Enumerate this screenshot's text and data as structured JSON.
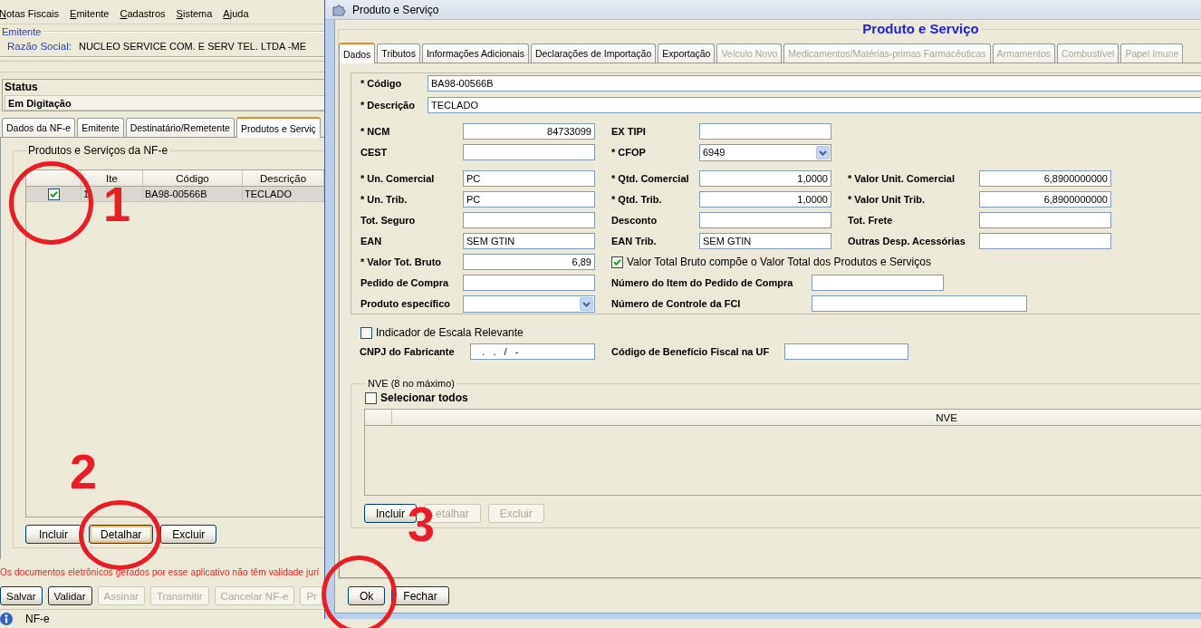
{
  "main_window": {
    "menu": [
      {
        "label": "Notas Fiscais"
      },
      {
        "label": "Emitente"
      },
      {
        "label": "Cadastros"
      },
      {
        "label": "Sistema"
      },
      {
        "label": "Ajuda"
      }
    ],
    "issuer": {
      "legend": "Emitente",
      "label": "Razão Social:",
      "value": "NUCLEO SERVICE COM. E SERV TEL. LTDA -ME"
    },
    "status": {
      "label": "Status",
      "value": "Em Digitação"
    },
    "tabs": [
      {
        "label": "Dados da NF-e",
        "selected": false
      },
      {
        "label": "Emitente",
        "selected": false
      },
      {
        "label": "Destinatário/Remetente",
        "selected": false
      },
      {
        "label": "Produtos e Serviç",
        "selected": true
      }
    ],
    "products": {
      "legend": "Produtos e Serviços da NF-e",
      "columns": [
        "Ite",
        "Código",
        "Descrição"
      ],
      "rows": [
        {
          "selected": true,
          "checked": true,
          "cells": [
            "1",
            "BA98-00566B",
            "TECLADO"
          ]
        }
      ],
      "buttons": [
        {
          "label": "Incluir",
          "focused": false
        },
        {
          "label": "Detalhar",
          "focused": true
        },
        {
          "label": "Excluir",
          "focused": false
        }
      ]
    },
    "notice": "Os documentos eletrônicos gerados por esse aplicativo não têm validade jurí",
    "actions": [
      {
        "label": "Salvar",
        "disabled": false
      },
      {
        "label": "Validar",
        "disabled": false
      },
      {
        "label": "Assinar",
        "disabled": true
      },
      {
        "label": "Transmitir",
        "disabled": true
      },
      {
        "label": "Cancelar NF-e",
        "disabled": true
      },
      {
        "label": "Pr",
        "disabled": true
      }
    ],
    "status_bar": {
      "text": "NF-e"
    }
  },
  "dialog": {
    "title": "Produto e Serviço",
    "heading": "Produto e Serviço",
    "tabs": [
      {
        "label": "Dados",
        "selected": true,
        "disabled": false
      },
      {
        "label": "Tributos",
        "selected": false,
        "disabled": false
      },
      {
        "label": "Informações Adicionais",
        "selected": false,
        "disabled": false
      },
      {
        "label": "Declarações de Importação",
        "selected": false,
        "disabled": false
      },
      {
        "label": "Exportação",
        "selected": false,
        "disabled": false
      },
      {
        "label": "Veículo Novo",
        "selected": false,
        "disabled": true
      },
      {
        "label": "Medicamentos/Matérias-primas Farmacêuticas",
        "selected": false,
        "disabled": true
      },
      {
        "label": "Armamentos",
        "selected": false,
        "disabled": true
      },
      {
        "label": "Combustível",
        "selected": false,
        "disabled": true
      },
      {
        "label": "Papel Imune",
        "selected": false,
        "disabled": true
      }
    ],
    "header_fields": [
      {
        "label": "* Código",
        "value": "BA98-00566B"
      },
      {
        "label": "* Descrição",
        "value": "TECLADO"
      }
    ],
    "field_groups": [
      [
        [
          {
            "kind": "number",
            "label": "* NCM",
            "value": "84733099"
          },
          {
            "kind": "text",
            "label": "EX TIPI"
          }
        ],
        [
          {
            "kind": "text",
            "label": "CEST"
          },
          {
            "kind": "select",
            "label": "* CFOP",
            "value": "6949"
          }
        ]
      ],
      [
        [
          {
            "kind": "text",
            "label": "* Un. Comercial",
            "value": "PC"
          },
          {
            "kind": "number",
            "label": "* Qtd. Comercial",
            "value": "1,0000"
          },
          {
            "kind": "number",
            "label": "* Valor Unit. Comercial",
            "value": "6,8900000000"
          }
        ],
        [
          {
            "kind": "text",
            "label": "* Un. Trib.",
            "value": "PC"
          },
          {
            "kind": "number",
            "label": "* Qtd. Trib.",
            "value": "1,0000"
          },
          {
            "kind": "number",
            "label": "* Valor Unit Trib.",
            "value": "6,8900000000"
          }
        ],
        [
          {
            "kind": "text",
            "label": "Tot. Seguro"
          },
          {
            "kind": "text",
            "label": "Desconto"
          },
          {
            "kind": "text",
            "label": "Tot. Frete"
          }
        ],
        [
          {
            "kind": "text",
            "label": "EAN",
            "value": "SEM GTIN"
          },
          {
            "kind": "text",
            "label": "EAN Trib.",
            "value": "SEM GTIN"
          },
          {
            "kind": "text",
            "label": "Outras Desp. Acessórias"
          }
        ],
        [
          {
            "kind": "number",
            "label": "* Valor Tot. Bruto",
            "value": "6,89"
          },
          {
            "kind": "check",
            "label": "Valor Total Bruto compõe o Valor Total dos Produtos e Serviços",
            "checked": true
          }
        ],
        [
          {
            "kind": "text",
            "label": "Pedido de Compra"
          },
          {
            "kind": "wide",
            "label": "Número do Item do Pedido de Compra"
          }
        ],
        [
          {
            "kind": "select",
            "label": "Produto específico"
          },
          {
            "kind": "long",
            "label": "Número de Controle da FCI"
          }
        ]
      ]
    ],
    "scale_indicator": {
      "label": "Indicador de Escala Relevante",
      "checked": false
    },
    "manufacturer_fields": [
      {
        "label": "CNPJ do Fabricante",
        "value": "   .   .   /   -"
      },
      {
        "label": "Código de Benefício Fiscal na UF"
      }
    ],
    "nve": {
      "legend": "NVE (8 no máximo)",
      "select_all": {
        "label": "Selecionar todos",
        "checked": false
      },
      "columns": [
        "NVE"
      ],
      "buttons": [
        {
          "label": "Incluir",
          "disabled": false
        },
        {
          "label": "etalhar",
          "disabled": true
        },
        {
          "label": "Excluir",
          "disabled": true
        }
      ]
    },
    "buttons": [
      {
        "label": "Ok"
      },
      {
        "label": "Fechar"
      }
    ]
  },
  "annotations": [
    {
      "kind": "circle"
    },
    {
      "kind": "number",
      "label": "1"
    },
    {
      "kind": "number",
      "label": "2"
    },
    {
      "kind": "circle"
    },
    {
      "kind": "circle"
    },
    {
      "kind": "number",
      "label": "3"
    }
  ]
}
